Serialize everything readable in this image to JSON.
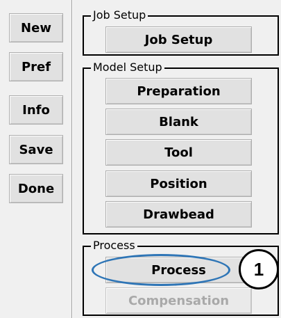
{
  "sidebar": {
    "buttons": [
      {
        "label": "New"
      },
      {
        "label": "Pref"
      },
      {
        "label": "Info"
      },
      {
        "label": "Save"
      },
      {
        "label": "Done"
      }
    ]
  },
  "groups": {
    "job_setup": {
      "legend": "Job Setup",
      "buttons": [
        {
          "label": "Job Setup"
        }
      ]
    },
    "model_setup": {
      "legend": "Model Setup",
      "buttons": [
        {
          "label": "Preparation"
        },
        {
          "label": "Blank"
        },
        {
          "label": "Tool"
        },
        {
          "label": "Position"
        },
        {
          "label": "Drawbead"
        }
      ]
    },
    "process": {
      "legend": "Process",
      "buttons": [
        {
          "label": "Process",
          "enabled": true
        },
        {
          "label": "Compensation",
          "enabled": false
        }
      ]
    }
  },
  "annotation": {
    "badge_number": "1",
    "ellipse_color": "#2e75b6"
  }
}
